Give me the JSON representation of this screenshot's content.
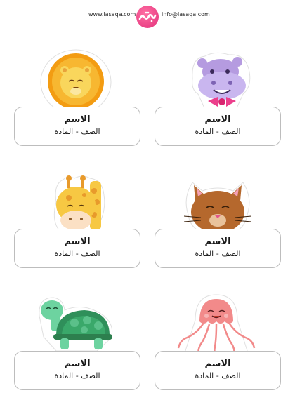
{
  "header": {
    "website": "www.lasaqa.com",
    "email": "info@lasaqa.com",
    "logo_text": "لصاقة"
  },
  "labels": [
    {
      "animal": "hippo-icon",
      "name": "الاسم",
      "subtitle": "الصف - المادة"
    },
    {
      "animal": "lion-icon",
      "name": "الاسم",
      "subtitle": "الصف - المادة"
    },
    {
      "animal": "cat-icon",
      "name": "الاسم",
      "subtitle": "الصف - المادة"
    },
    {
      "animal": "giraffe-icon",
      "name": "الاسم",
      "subtitle": "الصف - المادة"
    },
    {
      "animal": "jellyfish-icon",
      "name": "الاسم",
      "subtitle": "الصف - المادة"
    },
    {
      "animal": "turtle-icon",
      "name": "الاسم",
      "subtitle": "الصف - المادة"
    }
  ],
  "colors": {
    "logo": "#e2307a",
    "lion": "#f5a623",
    "hippo": "#b59be0",
    "cat": "#b5682d",
    "giraffe": "#f7c843",
    "jellyfish": "#f28a8a",
    "turtle": "#5bc08a"
  }
}
